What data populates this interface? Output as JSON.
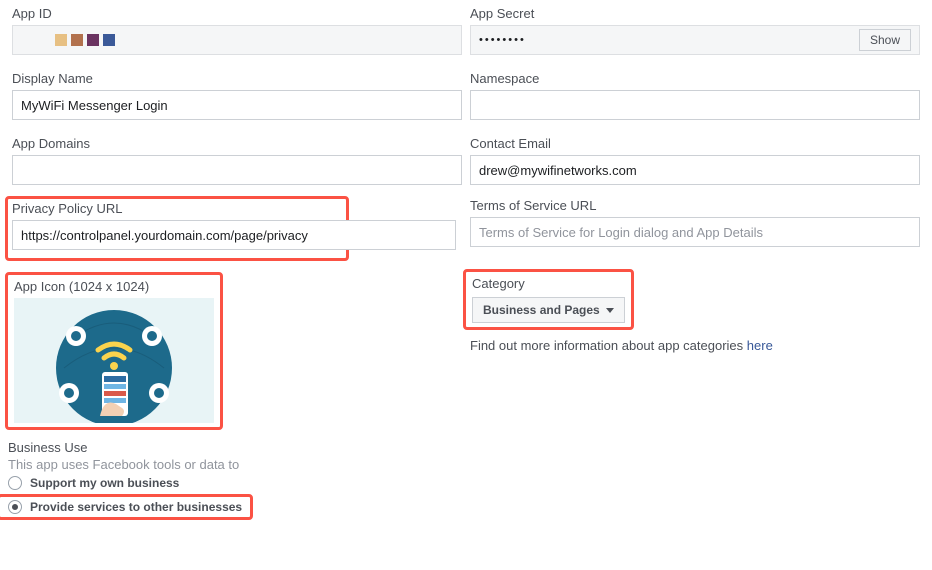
{
  "appId": {
    "label": "App ID"
  },
  "appSecret": {
    "label": "App Secret",
    "masked": "••••••••",
    "showLabel": "Show"
  },
  "displayName": {
    "label": "Display Name",
    "value": "MyWiFi Messenger Login"
  },
  "namespace": {
    "label": "Namespace",
    "value": ""
  },
  "appDomains": {
    "label": "App Domains",
    "value": ""
  },
  "contactEmail": {
    "label": "Contact Email",
    "value": "drew@mywifinetworks.com"
  },
  "privacyUrl": {
    "label": "Privacy Policy URL",
    "value": "https://controlpanel.yourdomain.com/page/privacy"
  },
  "tosUrl": {
    "label": "Terms of Service URL",
    "placeholder": "Terms of Service for Login dialog and App Details",
    "value": ""
  },
  "appIcon": {
    "label": "App Icon (1024 x 1024)"
  },
  "category": {
    "label": "Category",
    "selected": "Business and Pages",
    "helpText": "Find out more information about app categories ",
    "helpLink": "here"
  },
  "businessUse": {
    "label": "Business Use",
    "sub": "This app uses Facebook tools or data to",
    "option1": "Support my own business",
    "option2": "Provide services to other businesses"
  },
  "blockColors": [
    "#e7c083",
    "#b2714d",
    "#6b3361",
    "#3b5998"
  ]
}
